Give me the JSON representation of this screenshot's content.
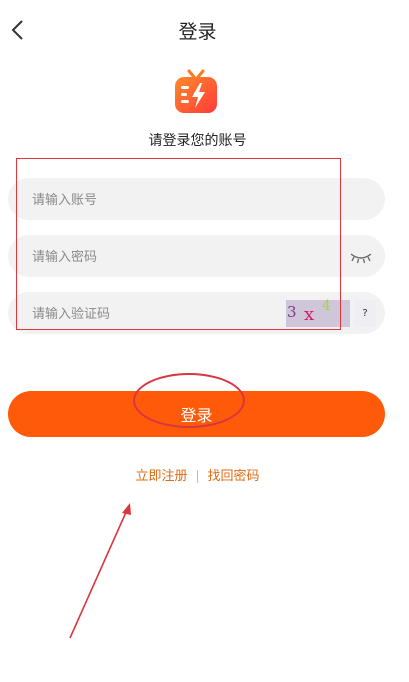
{
  "header": {
    "title": "登录",
    "back_icon": "chevron-left-icon"
  },
  "app": {
    "logo_icon": "tv-lightning-logo",
    "brand_color": "#ff6b1a"
  },
  "login": {
    "subtitle": "请登录您的账号",
    "account_placeholder": "请输入账号",
    "password_placeholder": "请输入密码",
    "captcha_placeholder": "请输入验证码",
    "captcha_chars": [
      "3",
      "x",
      "4"
    ],
    "captcha_help": "?",
    "password_visibility_icon": "eye-closed-icon",
    "submit_label": "登录",
    "submit_color": "#ff5a0a"
  },
  "links": {
    "register": "立即注册",
    "separator": "|",
    "forgot_password": "找回密码"
  },
  "annotations": {
    "color": "#e0353d"
  }
}
